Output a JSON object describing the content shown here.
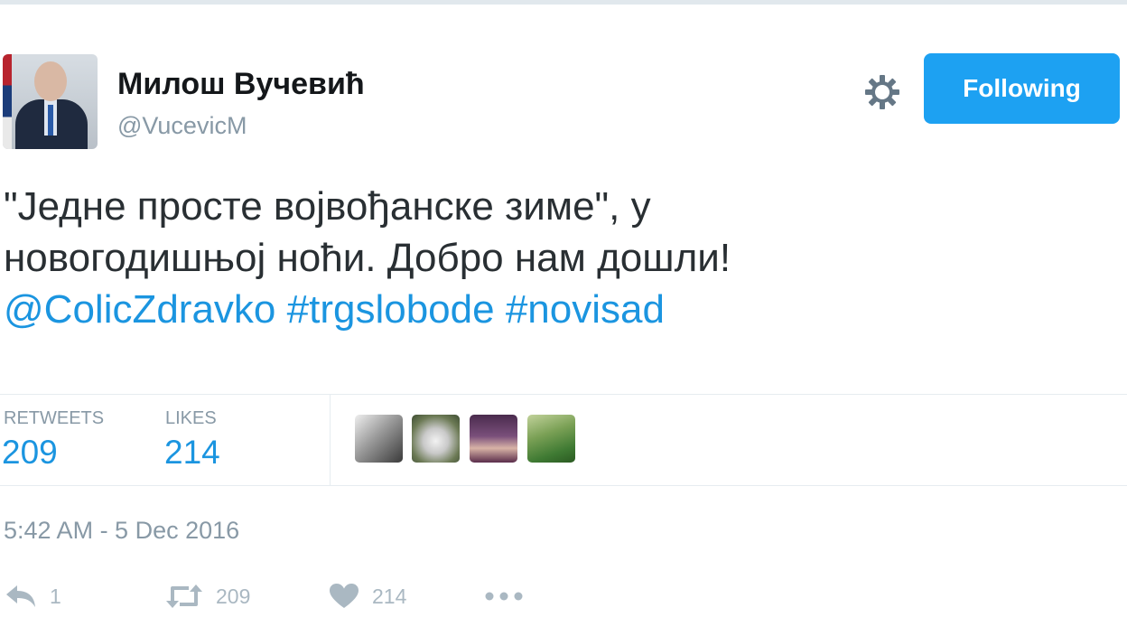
{
  "user": {
    "name": "Милош Вучевић",
    "handle": "@VucevicM"
  },
  "header": {
    "follow_label": "Following",
    "settings_icon": "gear-icon"
  },
  "tweet": {
    "line1": "\"Једне просте војвођанске зиме\", у",
    "line2": "новогодишњој ноћи. Добро нам дошли!",
    "mention": "@ColicZdravko",
    "hashtag1": "#trgslobode",
    "hashtag2": "#novisad",
    "link_color": "#1b95e0"
  },
  "stats": {
    "retweets_label": "RETWEETS",
    "retweets_value": "209",
    "likes_label": "LIKES",
    "likes_value": "214"
  },
  "timestamp": "5:42 AM - 5 Dec 2016",
  "actions": {
    "reply_count": "1",
    "retweet_count": "209",
    "like_count": "214",
    "reply_icon": "reply-icon",
    "retweet_icon": "retweet-icon",
    "like_icon": "heart-icon",
    "more_icon": "more-dots-icon"
  },
  "colors": {
    "accent": "#1da1f2",
    "muted": "#8899a6",
    "text": "#292f33"
  }
}
